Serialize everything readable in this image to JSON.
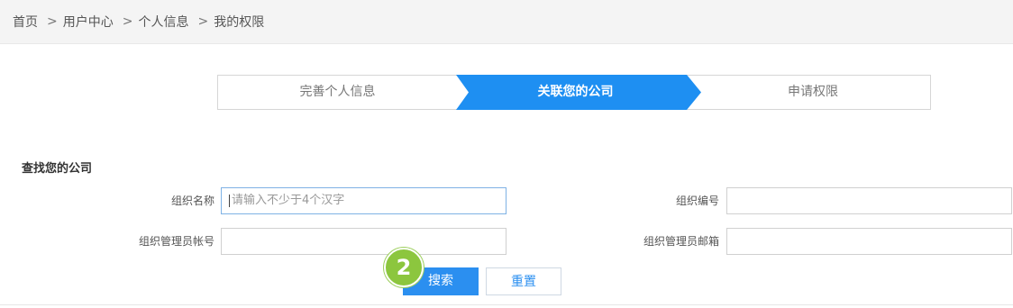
{
  "breadcrumb": {
    "items": [
      "首页",
      "用户中心",
      "个人信息",
      "我的权限"
    ],
    "separator": ">"
  },
  "steps": [
    {
      "label": "完善个人信息",
      "state": "done"
    },
    {
      "label": "关联您的公司",
      "state": "active"
    },
    {
      "label": "申请权限",
      "state": "pending"
    }
  ],
  "colors": {
    "accent": "#1e8ff2",
    "marker": "#8cc63e"
  },
  "search_section": {
    "title": "查找您的公司",
    "fields": {
      "org_name": {
        "label": "组织名称",
        "placeholder": "请输入不少于4个汉字",
        "value": ""
      },
      "org_code": {
        "label": "组织编号",
        "value": ""
      },
      "admin_account": {
        "label": "组织管理员帐号",
        "value": ""
      },
      "admin_email": {
        "label": "组织管理员邮箱",
        "value": ""
      }
    },
    "buttons": {
      "search": "搜索",
      "reset": "重置"
    },
    "step_marker": "2"
  }
}
